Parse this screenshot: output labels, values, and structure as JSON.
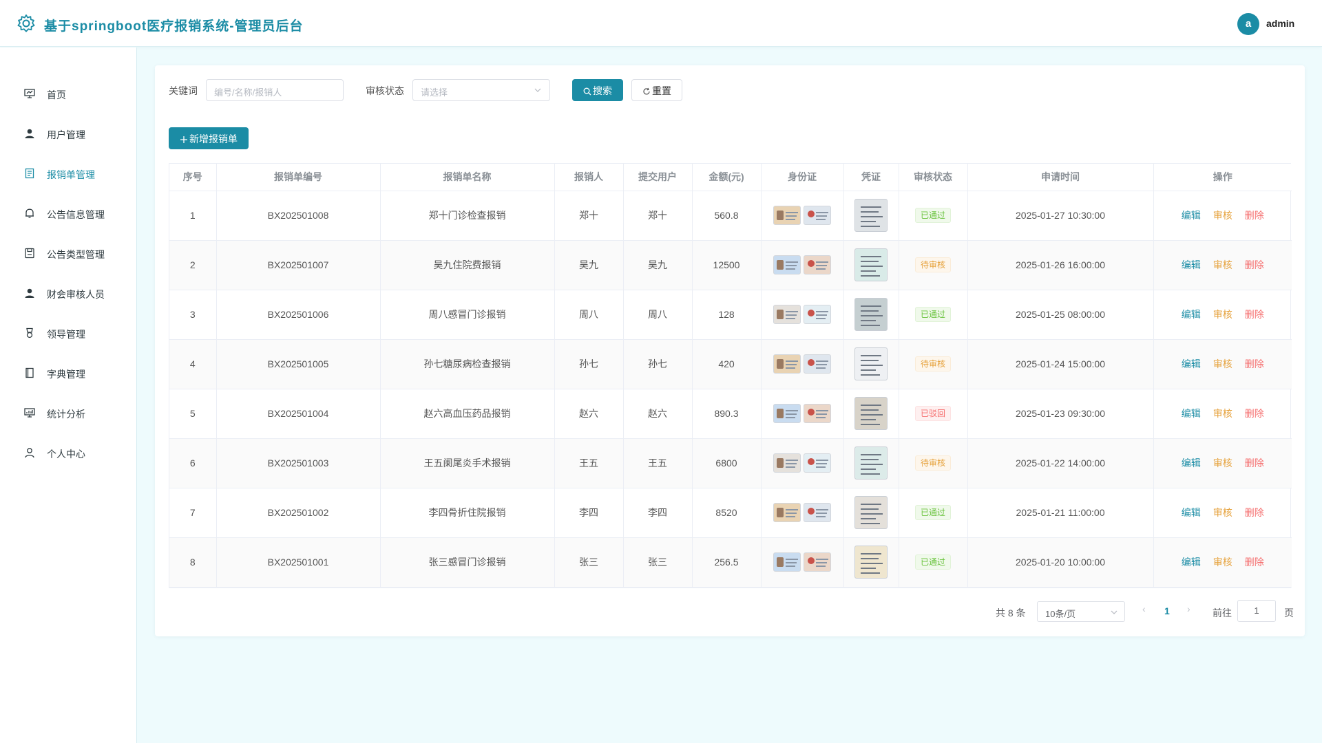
{
  "header": {
    "title": "基于springboot医疗报销系统-管理员后台",
    "avatar_letter": "a",
    "username": "admin",
    "accent": "#1b8ca5"
  },
  "sidebar": {
    "items": [
      {
        "label": "首页",
        "icon": "dashboard-icon"
      },
      {
        "label": "用户管理",
        "icon": "user-icon"
      },
      {
        "label": "报销单管理",
        "icon": "document-icon",
        "active": true
      },
      {
        "label": "公告信息管理",
        "icon": "bell-icon"
      },
      {
        "label": "公告类型管理",
        "icon": "save-icon"
      },
      {
        "label": "财会审核人员",
        "icon": "user-icon"
      },
      {
        "label": "领导管理",
        "icon": "medal-icon"
      },
      {
        "label": "字典管理",
        "icon": "book-icon"
      },
      {
        "label": "统计分析",
        "icon": "chart-icon"
      },
      {
        "label": "个人中心",
        "icon": "person-icon"
      }
    ]
  },
  "search": {
    "keyword_label": "关键词",
    "keyword_placeholder": "编号/名称/报销人",
    "status_label": "审核状态",
    "status_placeholder": "请选择",
    "search_button": "搜索",
    "reset_button": "重置"
  },
  "toolbar": {
    "add_button": "新增报销单"
  },
  "table": {
    "columns": [
      "序号",
      "报销单编号",
      "报销单名称",
      "报销人",
      "提交用户",
      "金额(元)",
      "身份证",
      "凭证",
      "审核状态",
      "申请时间",
      "操作"
    ],
    "actions": {
      "edit": "编辑",
      "audit": "审核",
      "delete": "删除"
    },
    "rows": [
      {
        "index": "1",
        "code": "BX202501008",
        "name": "郑十门诊检查报销",
        "claimant": "郑十",
        "submitter": "郑十",
        "amount": "560.8",
        "status": "已通过",
        "status_type": "success",
        "time": "2025-01-27 10:30:00"
      },
      {
        "index": "2",
        "code": "BX202501007",
        "name": "吴九住院费报销",
        "claimant": "吴九",
        "submitter": "吴九",
        "amount": "12500",
        "status": "待审核",
        "status_type": "warning",
        "time": "2025-01-26 16:00:00"
      },
      {
        "index": "3",
        "code": "BX202501006",
        "name": "周八感冒门诊报销",
        "claimant": "周八",
        "submitter": "周八",
        "amount": "128",
        "status": "已通过",
        "status_type": "success",
        "time": "2025-01-25 08:00:00"
      },
      {
        "index": "4",
        "code": "BX202501005",
        "name": "孙七糖尿病检查报销",
        "claimant": "孙七",
        "submitter": "孙七",
        "amount": "420",
        "status": "待审核",
        "status_type": "warning",
        "time": "2025-01-24 15:00:00"
      },
      {
        "index": "5",
        "code": "BX202501004",
        "name": "赵六高血压药品报销",
        "claimant": "赵六",
        "submitter": "赵六",
        "amount": "890.3",
        "status": "已驳回",
        "status_type": "danger",
        "time": "2025-01-23 09:30:00"
      },
      {
        "index": "6",
        "code": "BX202501003",
        "name": "王五阑尾炎手术报销",
        "claimant": "王五",
        "submitter": "王五",
        "amount": "6800",
        "status": "待审核",
        "status_type": "warning",
        "time": "2025-01-22 14:00:00"
      },
      {
        "index": "7",
        "code": "BX202501002",
        "name": "李四骨折住院报销",
        "claimant": "李四",
        "submitter": "李四",
        "amount": "8520",
        "status": "已通过",
        "status_type": "success",
        "time": "2025-01-21 11:00:00"
      },
      {
        "index": "8",
        "code": "BX202501001",
        "name": "张三感冒门诊报销",
        "claimant": "张三",
        "submitter": "张三",
        "amount": "256.5",
        "status": "已通过",
        "status_type": "success",
        "time": "2025-01-20 10:00:00"
      }
    ]
  },
  "pagination": {
    "total_text": "共 8 条",
    "page_size": "10条/页",
    "current_page": "1",
    "goto_label": "前往",
    "goto_value": "1",
    "page_unit": "页"
  }
}
